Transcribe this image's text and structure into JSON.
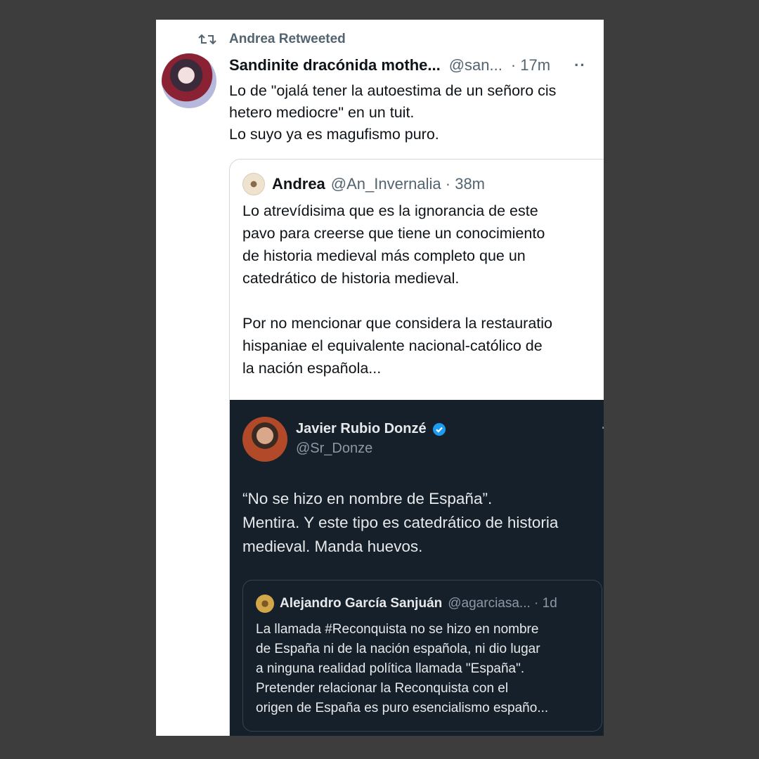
{
  "retweet": {
    "label": "Andrea Retweeted"
  },
  "tweet": {
    "name": "Sandinite dracónida mothe...",
    "handle": "@san...",
    "time": "· 17m",
    "more": "··",
    "lines": [
      "Lo de \"ojalá tener la autoestima de un señoro cis",
      "hetero mediocre\" en un tuit.",
      "Lo suyo ya es magufismo puro."
    ]
  },
  "quote": {
    "name": "Andrea",
    "handle": "@An_Invernalia · 38m",
    "lines": [
      "Lo atrevídisima que es la ignorancia de este",
      "pavo para creerse que tiene un conocimiento",
      "de historia medieval más completo que un",
      "catedrático de historia medieval.",
      "",
      "Por no mencionar que considera la restauratio",
      "hispaniae el equivalente nacional-católico de",
      "la nación española..."
    ]
  },
  "embedded": {
    "name": "Javier Rubio Donzé",
    "handle": "@Sr_Donze",
    "more": "···",
    "lines": [
      "“No se hizo en nombre de España”.",
      "Mentira. Y este tipo es catedrático de historia",
      "medieval. Manda huevos."
    ],
    "inner_quote": {
      "name": "Alejandro García Sanjuán",
      "handle": "@agarciasa... · 1d",
      "lines": [
        "La llamada #Reconquista no se hizo en nombre",
        "de España ni de la nación española, ni dio lugar",
        "a ninguna realidad política llamada \"España\".",
        "Pretender relacionar la Reconquista con el",
        "origen de España es puro esencialismo españo..."
      ]
    }
  },
  "colors": {
    "background": "#3d3d3d",
    "card": "#ffffff",
    "dark_embed": "#15202b",
    "secondary_text": "#536471",
    "verified": "#1d9bf0"
  }
}
